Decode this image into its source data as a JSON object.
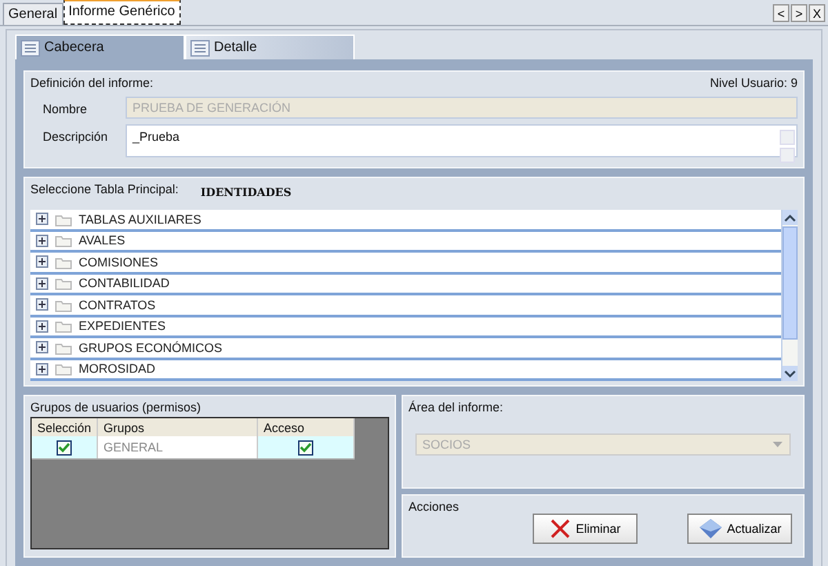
{
  "tabs": [
    {
      "label": "General",
      "selected": false
    },
    {
      "label": "Informe Genérico",
      "selected": true
    }
  ],
  "nav_buttons": [
    "<",
    ">",
    "X"
  ],
  "subtabs": [
    {
      "label": "Cabecera",
      "selected": true
    },
    {
      "label": "Detalle",
      "selected": false
    }
  ],
  "definition": {
    "title": "Definición del informe:",
    "user_level": "Nivel Usuario: 9",
    "name_label": "Nombre",
    "name_value": "PRUEBA DE GENERACIÓN",
    "name_disabled": true,
    "description_label": "Descripción",
    "description_value": "_Prueba"
  },
  "main_table": {
    "label": "Seleccione Tabla Principal:",
    "value": "IDENTIDADES",
    "items": [
      {
        "label": "TABLAS AUXILIARES",
        "expanded": false
      },
      {
        "label": "AVALES",
        "expanded": false
      },
      {
        "label": "COMISIONES",
        "expanded": false
      },
      {
        "label": "CONTABILIDAD",
        "expanded": false
      },
      {
        "label": "CONTRATOS",
        "expanded": false
      },
      {
        "label": "EXPEDIENTES",
        "expanded": false
      },
      {
        "label": "GRUPOS ECONÓMICOS",
        "expanded": false
      },
      {
        "label": "MOROSIDAD",
        "expanded": false
      }
    ]
  },
  "groups": {
    "title": "Grupos de usuarios (permisos)",
    "columns": [
      "Selección",
      "Grupos",
      "Acceso"
    ],
    "rows": [
      {
        "selected": true,
        "group": "GENERAL",
        "access": true
      }
    ]
  },
  "area": {
    "title": "Área del informe:",
    "value": "SOCIOS",
    "disabled": true
  },
  "actions": {
    "title": "Acciones",
    "buttons": [
      {
        "label": "Eliminar",
        "kind": "delete"
      },
      {
        "label": "Actualizar",
        "kind": "update"
      }
    ]
  }
}
